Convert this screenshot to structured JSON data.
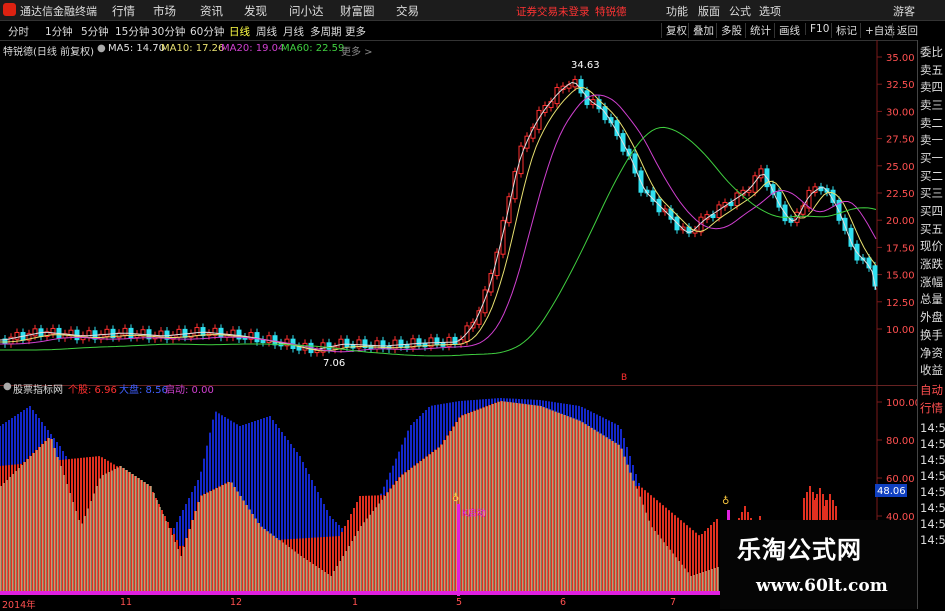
{
  "menubar": {
    "app_title": "通达信金融终端",
    "items": [
      "行情",
      "市场",
      "资讯",
      "发现",
      "问小达",
      "财富圈",
      "交易"
    ],
    "warning": "证券交易未登录",
    "stock_tag": "特锐德",
    "right_items": [
      "功能",
      "版面",
      "公式",
      "选项"
    ],
    "guest": "游客"
  },
  "toolbar": {
    "periods": [
      "分时",
      "1分钟",
      "5分钟",
      "15分钟",
      "30分钟",
      "60分钟",
      "日线",
      "周线",
      "月线",
      "多周期",
      "更多"
    ],
    "active": "日线",
    "right_buttons": [
      "复权",
      "叠加",
      "多股",
      "统计",
      "画线",
      "F10",
      "标记",
      "+自选",
      "返回"
    ]
  },
  "main_chart": {
    "stock_label": "特锐德(日线 前复权)",
    "ma_legend": [
      {
        "label": "MA5: 14.70",
        "color": "#e0e0e0"
      },
      {
        "label": "MA10: 17.26",
        "color": "#e8e070"
      },
      {
        "label": "MA20: 19.04",
        "color": "#d040d0"
      },
      {
        "label": "MA60: 22.59",
        "color": "#40d040"
      }
    ],
    "menu_arrow": "更多 >",
    "high_label": "34.63",
    "low_label": "7.06",
    "marker_b": "B",
    "y_ticks": [
      "35.00",
      "32.50",
      "30.00",
      "27.50",
      "25.00",
      "22.50",
      "20.00",
      "17.50",
      "15.00",
      "12.50",
      "10.00"
    ]
  },
  "indicator": {
    "title": "股票指标网",
    "values": [
      {
        "label": "个股: 6.96",
        "color": "#ff3030"
      },
      {
        "label": "大盘: 8.56",
        "color": "#4060ff"
      },
      {
        "label": "启动: 0.00",
        "color": "#d040d0"
      }
    ],
    "y_ticks": [
      "100.00",
      "80.00",
      "60.00",
      "40.00"
    ],
    "current_value": "48.06",
    "signal_label": "K启动"
  },
  "x_axis": [
    "2014年",
    "11",
    "12",
    "1",
    "5",
    "6",
    "7"
  ],
  "right_panel": [
    "委比",
    "卖五",
    "卖四",
    "卖三",
    "卖二",
    "卖一",
    "买一",
    "买二",
    "买三",
    "买四",
    "买五",
    "现价",
    "涨跌",
    "涨幅",
    "总量",
    "外盘",
    "换手",
    "净资",
    "收益",
    "自动",
    "行情",
    "14:5",
    "14:5",
    "14:5",
    "14:5",
    "14:5",
    "14:5",
    "14:5",
    "14:5"
  ],
  "watermark": {
    "title": "乐淘公式网",
    "url": "www.60lt.com"
  },
  "colors": {
    "up": "#ff3030",
    "down": "#30e0f0",
    "ma5": "#e0e0e0",
    "ma10": "#e8e070",
    "ma20": "#d040d0",
    "ma60": "#40d040",
    "blue_area": "#1428c8",
    "red_area": "#e03020"
  }
}
